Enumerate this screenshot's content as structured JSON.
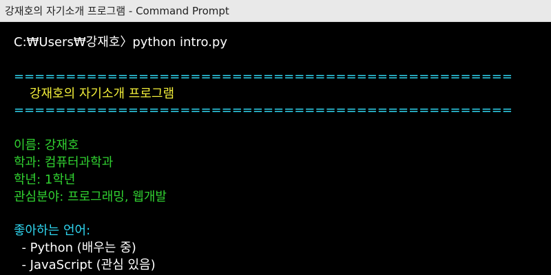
{
  "window": {
    "title": "강재호의 자기소개 프로그램 - Command Prompt"
  },
  "console": {
    "command_line": "C:₩Users₩강재호〉python intro.py",
    "separator_top": "================================================",
    "header": "    강재호의 자기소개 프로그램",
    "separator_bottom": "================================================",
    "name_line": "이름: 강재호",
    "major_line": "학과: 컴퓨터과학과",
    "year_line": "학년: 1학년",
    "interests_line": "관심분야: 프로그래밍, 웹개발",
    "languages_heading": "좋아하는 언어:",
    "languages": [
      "  - Python (배우는 중)",
      "  - JavaScript (관심 있음)"
    ]
  },
  "colors": {
    "background": "#000000",
    "titlebar": "#e9e9e9",
    "text_white": "#ffffff",
    "text_cyan": "#2fd6f0",
    "text_yellow": "#f2ee3a",
    "text_green": "#31d231"
  }
}
